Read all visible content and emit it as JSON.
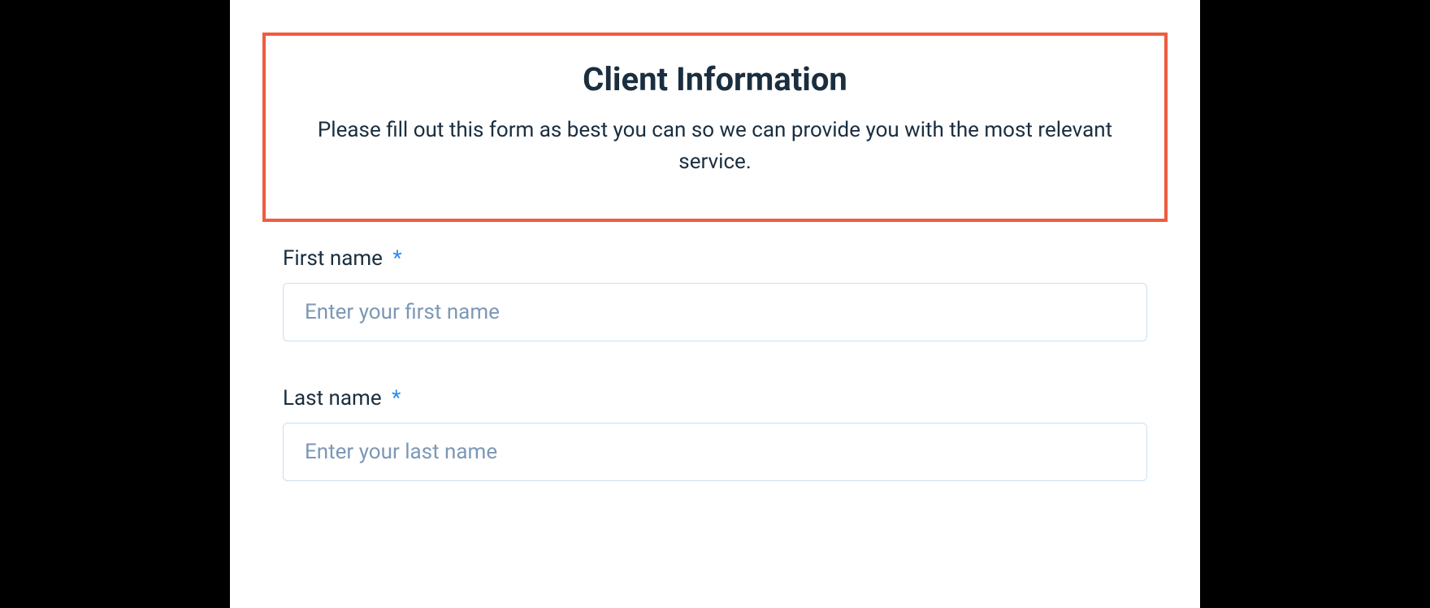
{
  "header": {
    "title": "Client Information",
    "description": "Please fill out this form as best you can so we can provide you with the most relevant service."
  },
  "fields": {
    "first_name": {
      "label": "First name",
      "placeholder": "Enter your first name",
      "value": "",
      "required": "*"
    },
    "last_name": {
      "label": "Last name",
      "placeholder": "Enter your last name",
      "value": "",
      "required": "*"
    }
  }
}
